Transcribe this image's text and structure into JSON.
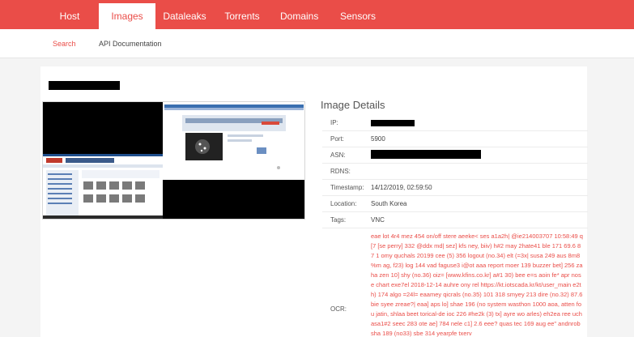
{
  "nav": {
    "tabs": [
      "Host",
      "Images",
      "Dataleaks",
      "Torrents",
      "Domains",
      "Sensors"
    ],
    "active": 1
  },
  "subnav": {
    "search": "Search",
    "api_docs": "API Documentation"
  },
  "colors": {
    "brand": "#ea4d48",
    "text": "#333333"
  },
  "details": {
    "title": "Image Details",
    "rows": [
      {
        "label": "IP:",
        "value": ""
      },
      {
        "label": "Port:",
        "value": "5900"
      },
      {
        "label": "ASN:",
        "value": ""
      },
      {
        "label": "RDNS:",
        "value": ""
      },
      {
        "label": "Timestamp:",
        "value": "14/12/2019, 02:59:50"
      },
      {
        "label": "Location:",
        "value": "South Korea"
      },
      {
        "label": "Tags:",
        "value": "VNC"
      }
    ],
    "ocr_label": "OCR:",
    "ocr_text": "eae lot 4r4 mez 454 on/off stere aeeke< ses a1a2h| @ie214003707 10:58:49 q [7 [se perry] 332 @ddx md| sez] kfs ney, biiv) h#2 may 2hate41 ble 171 69.6 87 1 omy quchals 20199 cee (5) 356 logout (no.34) elt (=3x| susa 249 aus 8m8 %m ag, f23) log 144 vad faguse3 i@ot aaa report moer 139 buzzer bet] 256 zaha zen 10] shy (no.36) oiz= [www.kfins.co.kr] a#1 30) bee e=s aoin fe* apr nose chart exe7el 2018-12-14 auhre ony rel https://kt.iotscada.kr/kt/user_main e2th) 174 algo =24l= eaamey qicrals (no.35) 101 318 smyey 213 dire (no.32) 87.6 bie syee zreae?| eaa] aps lo] shae 196 (no system wasthon 1000 aoa, atten fou jatin, shlaa beet torical-de ioc 226 #he2k (3) tx] ayre wo arles) eh2ea ree uchasa1#2 seec 283 ote ae] 784 nele c1] 2.6 eee? quas tec 169 aug ee\" andnrob sha 189 (no33) sbe 314 yearpfe txerv"
  }
}
